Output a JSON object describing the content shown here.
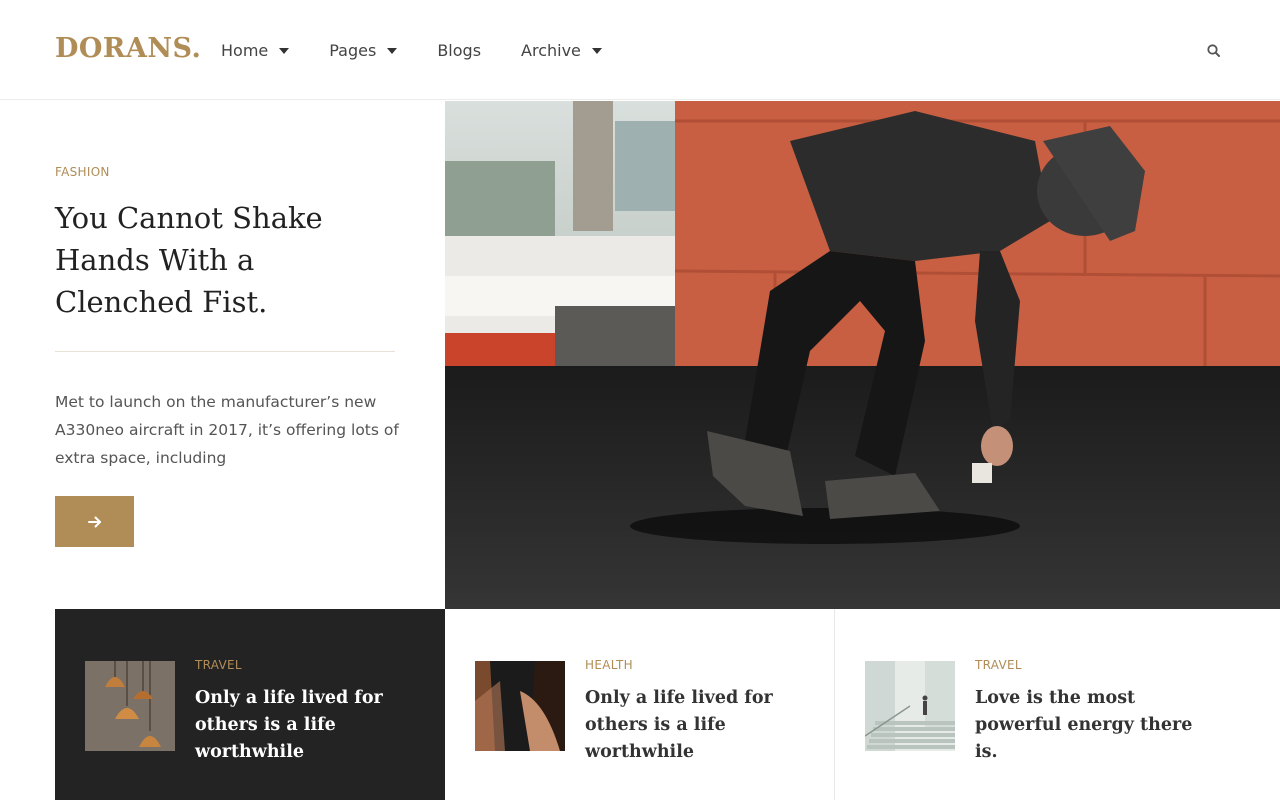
{
  "site": {
    "logo": "DORANS."
  },
  "nav": {
    "items": [
      {
        "label": "Home",
        "has_dropdown": true
      },
      {
        "label": "Pages",
        "has_dropdown": true
      },
      {
        "label": "Blogs",
        "has_dropdown": false
      },
      {
        "label": "Archive",
        "has_dropdown": true
      }
    ],
    "search_icon": "search-icon"
  },
  "hero": {
    "category": "FASHION",
    "title": "You Cannot Shake Hands With a Clenched Fist.",
    "excerpt": "Met to launch on the manufacturer’s new A330neo aircraft in 2017, it’s offering lots of extra space, including",
    "button_icon": "arrow-right-icon"
  },
  "cards": [
    {
      "category": "TRAVEL",
      "title": "Only a life lived for others is a life worthwhile",
      "theme": "dark"
    },
    {
      "category": "HEALTH",
      "title": "Only a life lived for others is a life worthwhile",
      "theme": "light"
    },
    {
      "category": "TRAVEL",
      "title": "Love is the most powerful energy there is.",
      "theme": "light"
    }
  ],
  "colors": {
    "accent": "#b08d57",
    "dark_card": "#232323",
    "text": "#222222"
  }
}
